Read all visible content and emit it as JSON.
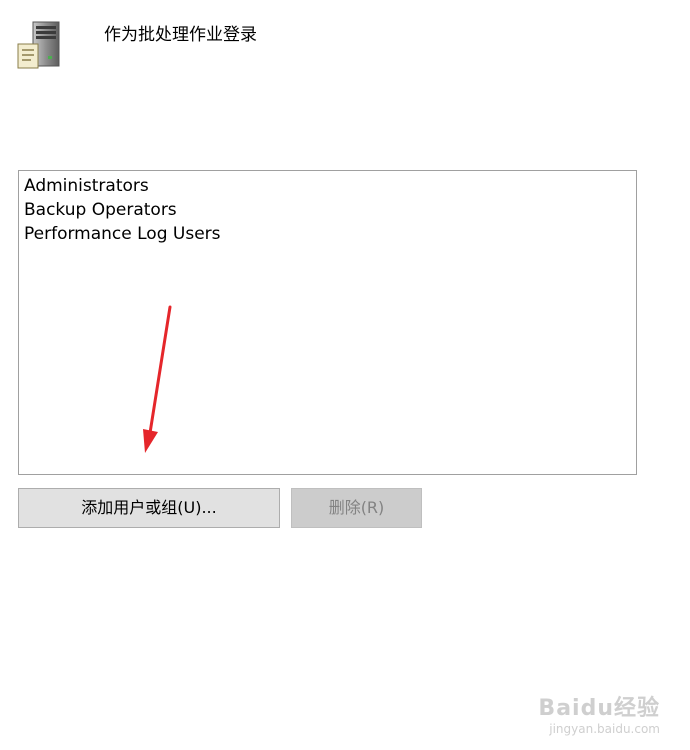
{
  "policy": {
    "icon": "server-policy-icon",
    "title": "作为批处理作业登录"
  },
  "members": {
    "items": [
      "Administrators",
      "Backup Operators",
      "Performance Log Users"
    ]
  },
  "buttons": {
    "add_label": "添加用户或组(U)...",
    "remove_label": "删除(R)",
    "remove_enabled": false
  },
  "annotation": {
    "arrow_color": "#e5262b",
    "icon": "red-arrow-icon"
  },
  "watermark": {
    "brand": "Baidu经验",
    "url": "jingyan.baidu.com"
  },
  "colors": {
    "list_border": "#a0a0a0",
    "button_bg": "#e1e1e1",
    "button_disabled_bg": "#cccccc",
    "button_disabled_text": "#838383"
  }
}
